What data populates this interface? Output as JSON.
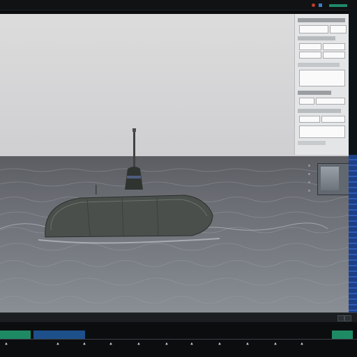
{
  "window": {
    "title": ""
  },
  "colors": {
    "sky": "#d6d6d8",
    "sea": "#6b6e74",
    "hull": "#4a4f4b",
    "accent_green": "#1f8a6b",
    "accent_blue": "#1d4f8a"
  },
  "viewport": {
    "label": ""
  },
  "timeline": {
    "frame_label": "",
    "tick_icons": [
      "keyframe-icon",
      "keyframe-icon",
      "keyframe-icon",
      "keyframe-icon",
      "keyframe-icon",
      "keyframe-icon",
      "keyframe-icon",
      "keyframe-icon",
      "keyframe-icon",
      "keyframe-icon",
      "keyframe-icon"
    ]
  },
  "status": {
    "text": ""
  }
}
